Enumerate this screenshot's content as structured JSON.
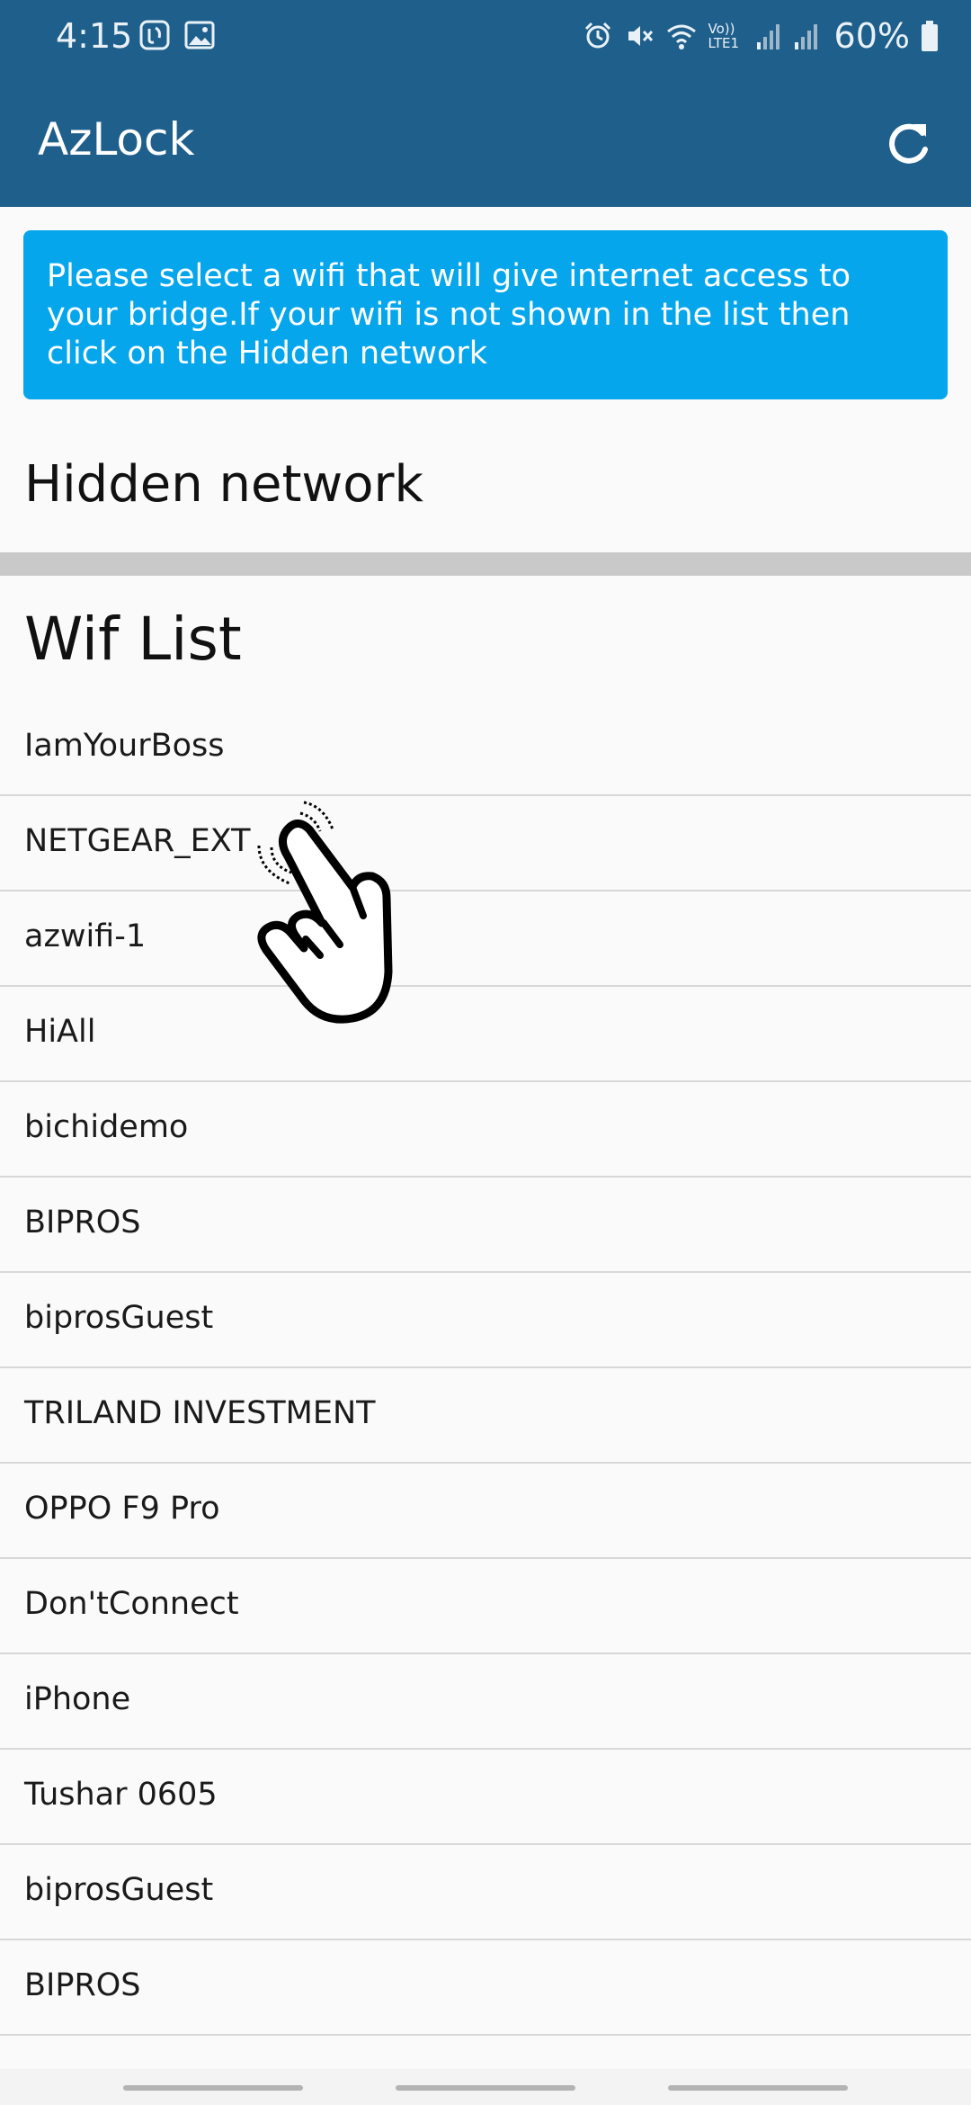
{
  "status_bar": {
    "time": "4:15",
    "battery": "60%",
    "icons": [
      "jiosaavn-icon",
      "gallery-icon",
      "alarm-icon",
      "mute-icon",
      "wifi-icon",
      "volte-icon",
      "signal-icon",
      "signal-icon",
      "battery-icon"
    ],
    "volte_label": "Vo)) LTE1"
  },
  "app_bar": {
    "title": "AzLock",
    "refresh_icon": "refresh-icon"
  },
  "info_card": {
    "text": "Please select a wifi that will give internet access to your bridge.If your wifi is not shown in the list then click on the Hidden network"
  },
  "hidden_network": {
    "label": "Hidden network"
  },
  "wifi_list": {
    "title": "Wif List",
    "items": [
      "IamYourBoss",
      "NETGEAR_EXT",
      "azwifi-1",
      "HiAll",
      "bichidemo",
      "BIPROS",
      "biprosGuest",
      "TRILAND INVESTMENT",
      "OPPO F9 Pro",
      "Don'tConnect",
      "iPhone",
      "Tushar 0605",
      "biprosGuest",
      "BIPROS"
    ]
  },
  "overlay": {
    "tap_hint_icon": "tap-hand-icon"
  },
  "colors": {
    "app_bar": "#1f5f8b",
    "info_card": "#05a6ec",
    "divider": "#c9c9c9",
    "background": "#fafafa"
  }
}
